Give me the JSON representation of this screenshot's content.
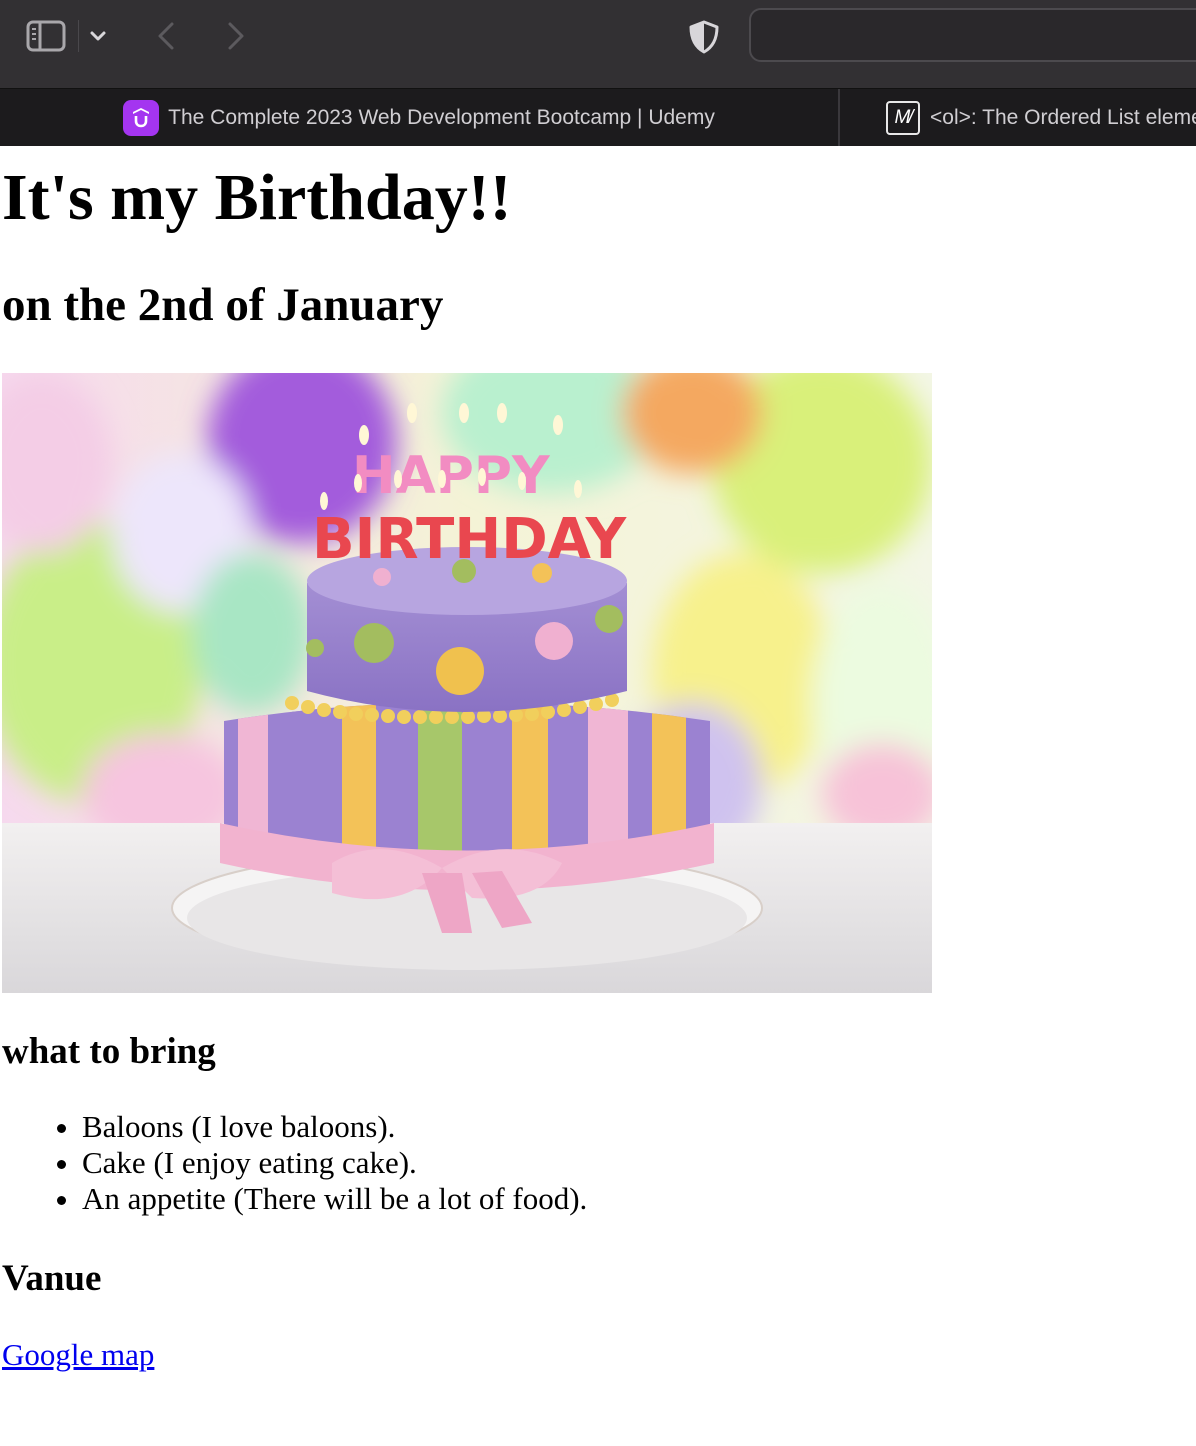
{
  "browser": {
    "tabs": [
      {
        "title": "The Complete 2023 Web Development Bootcamp | Udemy",
        "favicon": "udemy-icon"
      },
      {
        "title": "<ol>: The Ordered List element - HTML: HyperText Markup Language | MDN",
        "favicon": "mdn-icon"
      }
    ],
    "address_value": ""
  },
  "page": {
    "heading": "It's my Birthday!!",
    "subheading": "on the 2nd of January",
    "image": {
      "candle_letters_top": "HAPPY",
      "candle_letters_bottom": "BIRTHDAY"
    },
    "bring_heading": "what to bring",
    "bring_items": [
      "Baloons (I love baloons).",
      "Cake (I enjoy eating cake).",
      "An appetite (There will be a lot of food)."
    ],
    "venue_heading": "Vanue",
    "map_link": "Google map"
  },
  "colors": {
    "link": "#0000ee",
    "udemy": "#a435f0",
    "chrome": "#323033"
  }
}
